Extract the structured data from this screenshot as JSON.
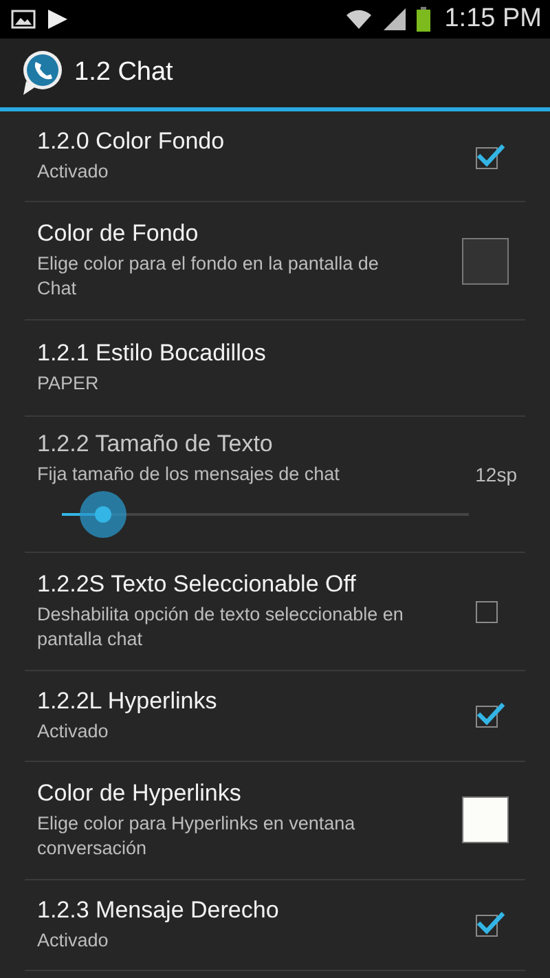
{
  "status_bar": {
    "time": "1:15 PM"
  },
  "action_bar": {
    "title": "1.2 Chat"
  },
  "items": [
    {
      "kind": "checkbox",
      "title": "1.2.0 Color Fondo",
      "summary": "Activado",
      "checked": true
    },
    {
      "kind": "color",
      "title": "Color de Fondo",
      "summary": "Elige color para el fondo en la pantalla de Chat",
      "color": "#333333"
    },
    {
      "kind": "plain",
      "title": "1.2.1 Estilo Bocadillos",
      "summary": "PAPER"
    },
    {
      "kind": "slider",
      "title": "1.2.2 Tamaño de Texto",
      "summary": "Fija tamaño de los mensajes de chat",
      "reading": "12sp"
    },
    {
      "kind": "checkbox",
      "title": "1.2.2S Texto Seleccionable Off",
      "summary": "Deshabilita opción de texto seleccionable en pantalla chat",
      "checked": false
    },
    {
      "kind": "checkbox",
      "title": "1.2.2L Hyperlinks",
      "summary": "Activado",
      "checked": true
    },
    {
      "kind": "color",
      "title": "Color de Hyperlinks",
      "summary": "Elige color para Hyperlinks en ventana conversación",
      "color": "#fcfcf8"
    },
    {
      "kind": "checkbox",
      "title": "1.2.3 Mensaje Derecho",
      "summary": "Activado",
      "checked": true
    }
  ]
}
